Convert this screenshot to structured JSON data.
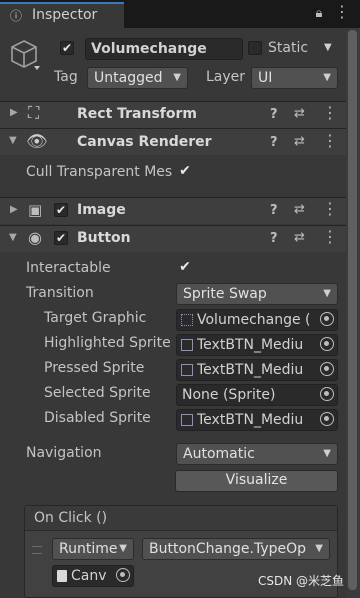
{
  "tab": {
    "title": "Inspector"
  },
  "gameobject": {
    "active": true,
    "name": "Volumechange",
    "static_label": "Static",
    "static": false,
    "tag_label": "Tag",
    "tag_value": "Untagged",
    "layer_label": "Layer",
    "layer_value": "UI"
  },
  "components": {
    "rect_transform": {
      "title": "Rect Transform"
    },
    "canvas_renderer": {
      "title": "Canvas Renderer",
      "cull_label": "Cull Transparent Mes",
      "cull_checked": true
    },
    "image": {
      "title": "Image",
      "enabled": true
    },
    "button": {
      "title": "Button",
      "enabled": true,
      "interactable_label": "Interactable",
      "interactable": true,
      "transition_label": "Transition",
      "transition_value": "Sprite Swap",
      "target_graphic_label": "Target Graphic",
      "target_graphic_value": "Volumechange (",
      "highlighted_label": "Highlighted Sprite",
      "highlighted_value": "TextBTN_Mediu",
      "pressed_label": "Pressed Sprite",
      "pressed_value": "TextBTN_Mediu",
      "selected_label": "Selected Sprite",
      "selected_value": "None (Sprite)",
      "disabled_label": "Disabled Sprite",
      "disabled_value": "TextBTN_Mediu",
      "navigation_label": "Navigation",
      "navigation_value": "Automatic",
      "visualize_label": "Visualize",
      "onclick": {
        "header": "On Click ()",
        "runtime_value": "Runtime",
        "function_value": "ButtonChange.TypeOp",
        "object_value": "Canv"
      }
    }
  },
  "watermark": "CSDN @米芝鱼",
  "colors": {
    "accent": "#3a79bb",
    "background": "#383838",
    "header": "#3e3e3e"
  }
}
